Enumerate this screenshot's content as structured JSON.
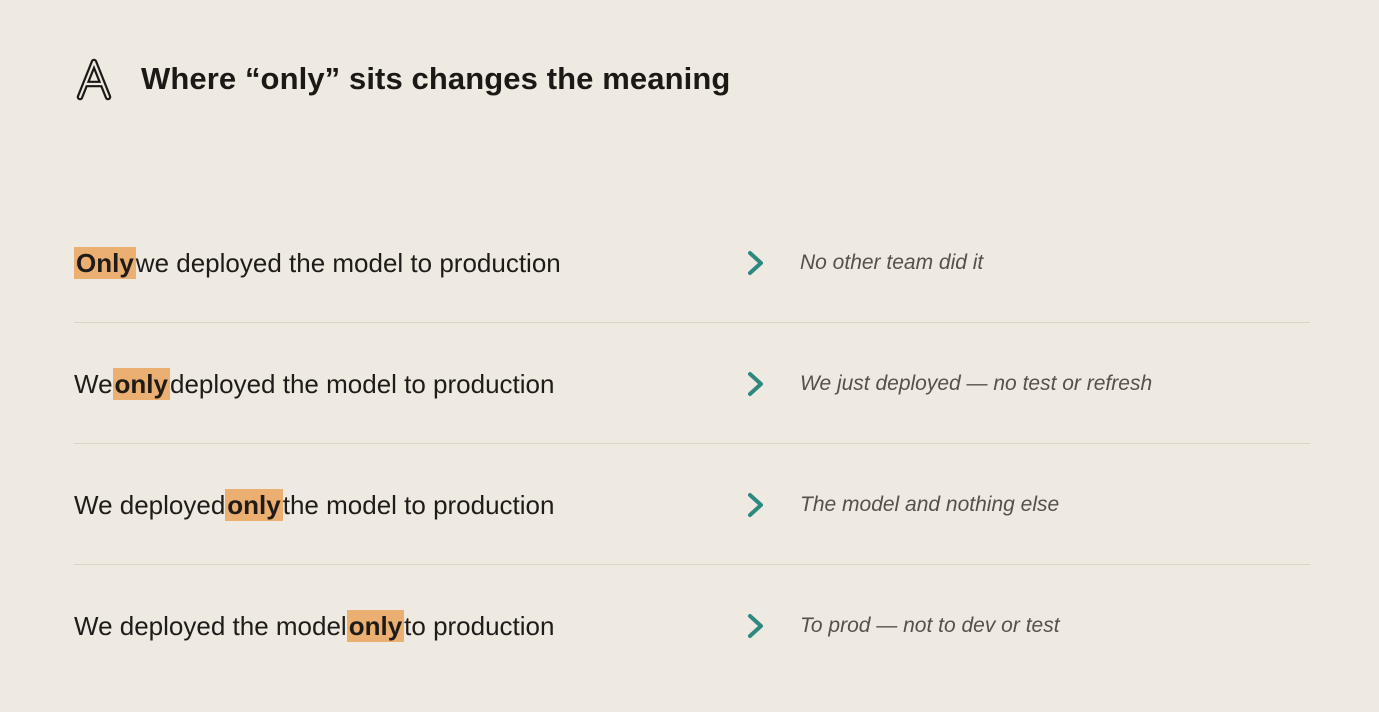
{
  "header": {
    "logo_icon": "anthropic-a-icon",
    "title": "Where “only” sits changes the meaning"
  },
  "colors": {
    "background": "#EEE9E1",
    "highlight": "#EBB071",
    "arrow": "#2E8882",
    "divider": "#D9D3CA",
    "note_text": "#55504A"
  },
  "rows": [
    {
      "before": "",
      "highlight": "Only",
      "after": "we deployed the model to production",
      "arrow_icon": "chevron-right-icon",
      "meaning": "No other team did it"
    },
    {
      "before": "We",
      "highlight": "only",
      "after": "deployed the model to production",
      "arrow_icon": "chevron-right-icon",
      "meaning": "We just deployed — no test or refresh"
    },
    {
      "before": "We deployed",
      "highlight": "only",
      "after": "the model to production",
      "arrow_icon": "chevron-right-icon",
      "meaning": "The model and nothing else"
    },
    {
      "before": "We deployed the model",
      "highlight": "only",
      "after": "to production",
      "arrow_icon": "chevron-right-icon",
      "meaning": "To prod — not to dev or test"
    }
  ]
}
